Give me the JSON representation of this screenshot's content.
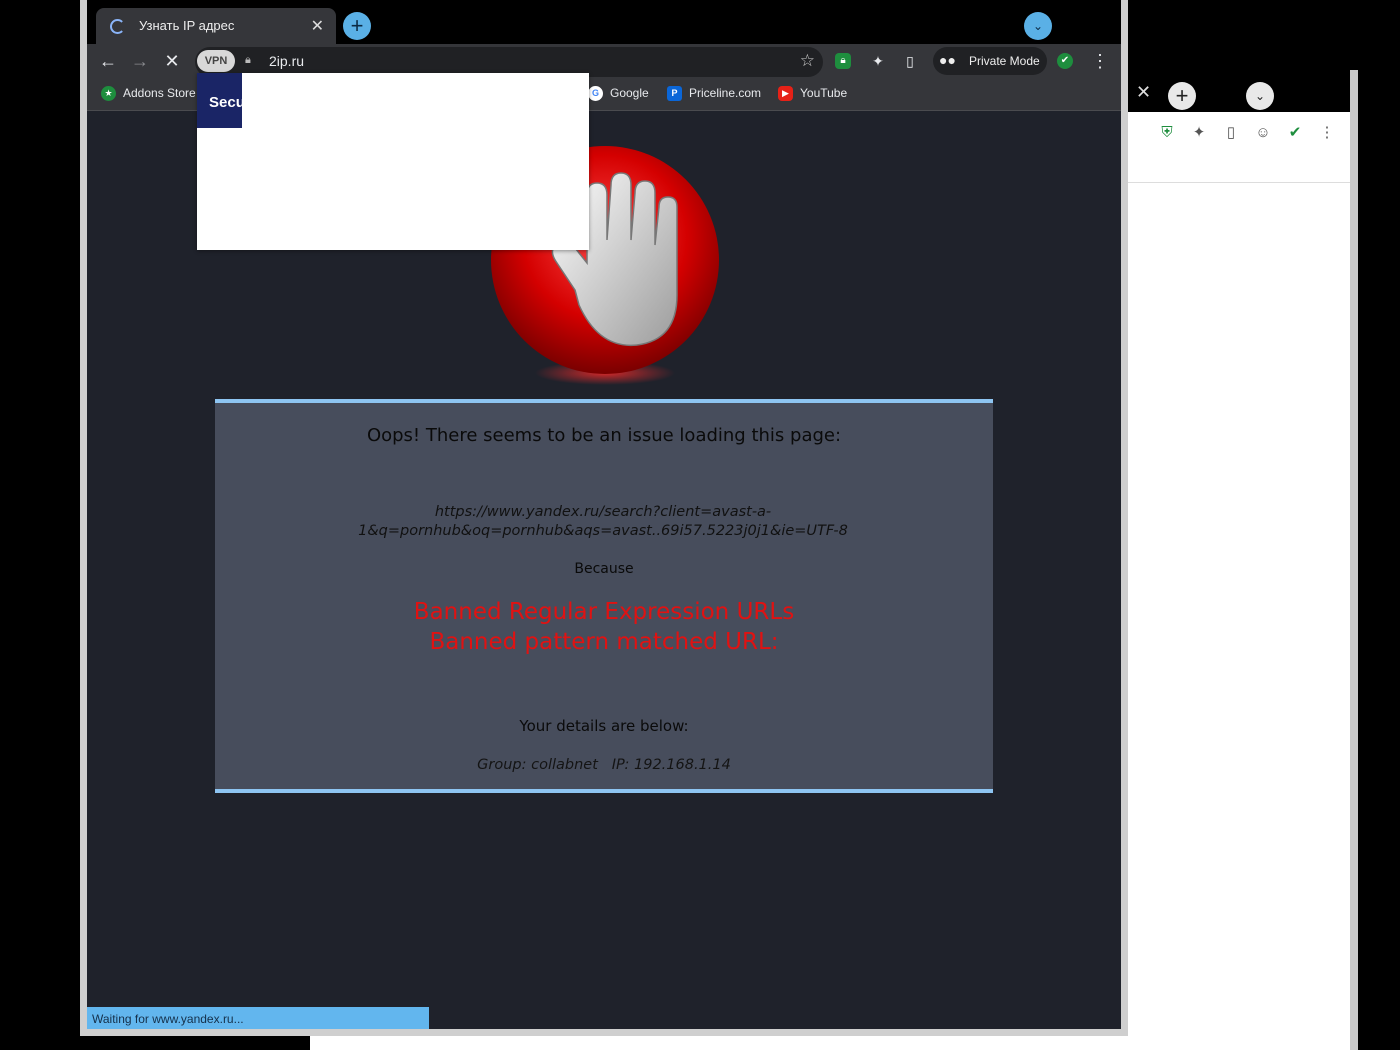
{
  "browser": {
    "tab_title": "Узнать IP адрес",
    "tab_close": "✕",
    "new_tab": "+",
    "tab_search": "⌄",
    "url": "2ip.ru",
    "vpn_label": "VPN",
    "private_mode_label": "Private Mode"
  },
  "bookmarks": [
    {
      "label": "Addons Store",
      "icon": "addons-store-icon",
      "color": "#1e8e3e"
    },
    {
      "label": "Google",
      "icon": "google-icon",
      "color": "#ffffff"
    },
    {
      "label": "Priceline.com",
      "icon": "priceline-icon",
      "color": "#0a66d8"
    },
    {
      "label": "YouTube",
      "icon": "youtube-icon",
      "color": "#e62117"
    }
  ],
  "popup": {
    "partial_label": "Secu"
  },
  "block_page": {
    "title": "Oops! There seems to be an issue loading this page:",
    "url_line1": "https://www.yandex.ru/search?client=avast-a-",
    "url_line2": "1&q=pornhub&oq=pornhub&aqs=avast..69i57.5223j0j1&ie=UTF-8",
    "because": "Because",
    "reason_line1": "Banned Regular Expression URLs",
    "reason_line2": "Banned pattern matched URL:",
    "details_heading": "Your details are below:",
    "group_line": "Group: collabnet   IP: 192.168.1.14"
  },
  "status_bar": "Waiting for www.yandex.ru...",
  "second_window": {
    "close": "✕",
    "new_tab": "+",
    "tab_search": "⌄"
  },
  "colors": {
    "accent": "#5ab0e6",
    "panel_border": "#8ec5f2",
    "reason_red": "#e01212"
  }
}
